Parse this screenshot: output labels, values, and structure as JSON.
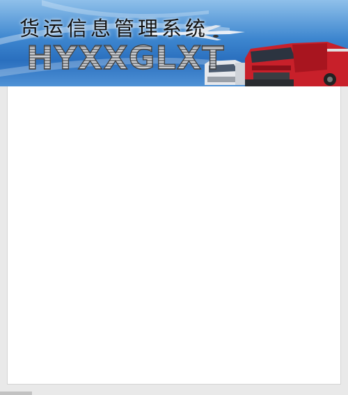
{
  "header": {
    "title": "货运信息管理系统",
    "subtitle": "HYXXGLXT"
  },
  "colors": {
    "banner_sky": "#3d86cf",
    "truck_red": "#c8202a",
    "truck_white": "#e6e8ec",
    "content_bg": "#ffffff",
    "page_bg": "#e9e9e9"
  },
  "icons": {
    "banner_art": "trucks-and-airplane-illustration"
  }
}
